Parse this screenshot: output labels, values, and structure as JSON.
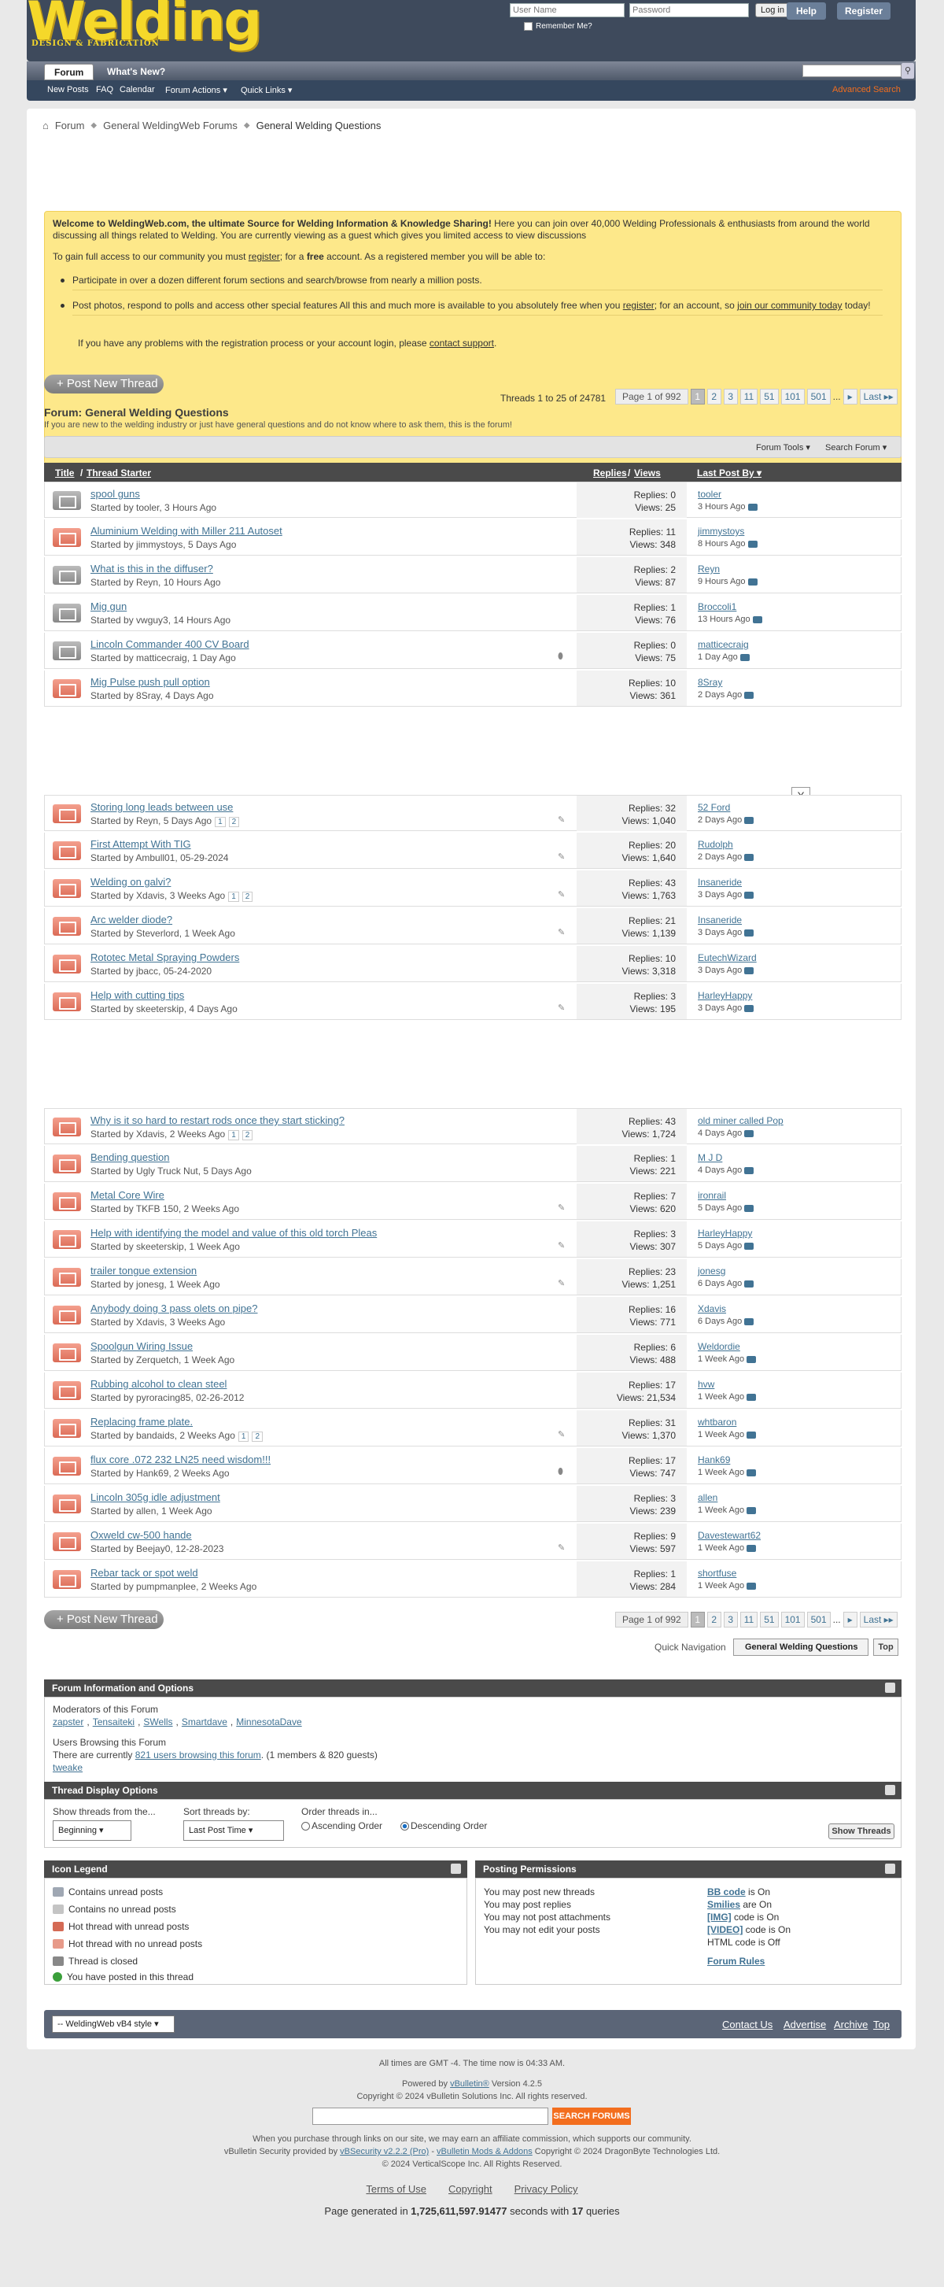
{
  "header": {
    "logo_main": "Welding",
    "logo_sub": "DESIGN & FABRICATION",
    "username_placeholder": "User Name",
    "password_placeholder": "Password",
    "login_button": "Log in",
    "remember_me": "Remember Me?",
    "help": "Help",
    "register": "Register"
  },
  "nav": {
    "tabs": [
      {
        "label": "Forum"
      },
      {
        "label": "What's New?"
      }
    ],
    "sub": [
      "New Posts",
      "FAQ",
      "Calendar",
      "Forum Actions ▾",
      "Quick Links ▾"
    ],
    "advanced_search": "Advanced Search"
  },
  "breadcrumb": [
    "Forum",
    "General WeldingWeb Forums",
    "General Welding Questions"
  ],
  "notice": {
    "welcome_bold": "Welcome to WeldingWeb.com, the ultimate Source for Welding Information & Knowledge Sharing!",
    "welcome_rest": " Here you can join over 40,000 Welding Professionals & enthusiasts from around the world discussing all things related to Welding. You are currently viewing as a guest which gives you limited access to view discussions",
    "access_a": "To gain full access to our community you must ",
    "access_link": "register",
    "access_b": "; for a ",
    "access_free": "free",
    "access_c": " account. As a registered member you will be able to:",
    "bullet1": "Participate in over a dozen different forum sections and search/browse from nearly a million posts.",
    "bullet2_a": "Post photos, respond to polls and access other special features All this and much more is available to you absolutely free when you ",
    "bullet2_link": "register",
    "bullet2_b": "; for an account, so ",
    "bullet2_link2": "join our community today",
    "bullet2_c": " today!",
    "problems_a": "If you have any problems with the registration process or your account login, please ",
    "problems_link": "contact support",
    "problems_b": "."
  },
  "post_new_thread": "+ Post New Thread",
  "threads_info": "Threads 1 to 25 of 24781",
  "pagination": {
    "label": "Page 1 of 992",
    "pages": [
      "1",
      "2",
      "3",
      "11",
      "51",
      "101",
      "501",
      "...",
      "▸",
      "Last ▸▸"
    ]
  },
  "forum": {
    "title": "Forum: General Welding Questions",
    "description": "If you are new to the welding industry or just have general questions and do not know where to ask them, this is the forum!",
    "tools": "Forum Tools ▾",
    "search": "Search Forum ▾"
  },
  "columns": {
    "title": "Title",
    "starter": "Thread Starter",
    "replies": "Replies",
    "views": "Views",
    "last_post": "Last Post By ▾"
  },
  "threads_group1": [
    {
      "title": "spool guns",
      "starter": "Started by tooler, 3 Hours Ago",
      "replies": "Replies: 0",
      "views": "Views: 25",
      "last_by": "tooler",
      "last_date": "3 Hours Ago",
      "icon": "gray"
    },
    {
      "title": "Aluminium Welding with Miller 211 Autoset",
      "starter": "Started by jimmystoys, 5 Days Ago",
      "replies": "Replies: 11",
      "views": "Views: 348",
      "last_by": "jimmystoys",
      "last_date": "8 Hours Ago",
      "icon": "hot"
    },
    {
      "title": "What is this in the diffuser?",
      "starter": "Started by Reyn, 10 Hours Ago",
      "replies": "Replies: 2",
      "views": "Views: 87",
      "last_by": "Reyn",
      "last_date": "9 Hours Ago",
      "icon": "gray"
    },
    {
      "title": "Mig gun",
      "starter": "Started by vwguy3, 14 Hours Ago",
      "replies": "Replies: 1",
      "views": "Views: 76",
      "last_by": "Broccoli1",
      "last_date": "13 Hours Ago",
      "icon": "gray"
    },
    {
      "title": "Lincoln Commander 400 CV Board",
      "starter": "Started by matticecraig, 1 Day Ago",
      "replies": "Replies: 0",
      "views": "Views: 75",
      "last_by": "matticecraig",
      "last_date": "1 Day Ago",
      "icon": "gray"
    },
    {
      "title": "Mig Pulse push pull option",
      "starter": "Started by 8Sray, 4 Days Ago",
      "replies": "Replies: 10",
      "views": "Views: 361",
      "last_by": "8Sray",
      "last_date": "2 Days Ago",
      "icon": "hot"
    }
  ],
  "ad_close": "X",
  "threads_group2": [
    {
      "title": "Storing long leads between use",
      "starter": "Started by Reyn, 5 Days Ago",
      "pages": [
        "1",
        "2"
      ],
      "replies": "Replies: 32",
      "views": "Views: 1,040",
      "last_by": "52 Ford",
      "last_date": "2 Days Ago"
    },
    {
      "title": "First Attempt With TIG",
      "starter": "Started by Ambull01, 05-29-2024",
      "replies": "Replies: 20",
      "views": "Views: 1,640",
      "last_by": "Rudolph",
      "last_date": "2 Days Ago"
    },
    {
      "title": "Welding on galvi?",
      "starter": "Started by Xdavis, 3 Weeks Ago",
      "pages": [
        "1",
        "2"
      ],
      "replies": "Replies: 43",
      "views": "Views: 1,763",
      "last_by": "Insaneride",
      "last_date": "3 Days Ago"
    },
    {
      "title": "Arc welder diode?",
      "starter": "Started by Steverlord, 1 Week Ago",
      "replies": "Replies: 21",
      "views": "Views: 1,139",
      "last_by": "Insaneride",
      "last_date": "3 Days Ago"
    },
    {
      "title": "Rototec Metal Spraying Powders",
      "starter": "Started by jbacc, 05-24-2020",
      "replies": "Replies: 10",
      "views": "Views: 3,318",
      "last_by": "EutechWizard",
      "last_date": "3 Days Ago"
    },
    {
      "title": "Help with cutting tips",
      "starter": "Started by skeeterskip, 4 Days Ago",
      "replies": "Replies: 3",
      "views": "Views: 195",
      "last_by": "HarleyHappy",
      "last_date": "3 Days Ago"
    }
  ],
  "threads_group3": [
    {
      "title": "Why is it so hard to restart rods once they start sticking?",
      "starter": "Started by Xdavis, 2 Weeks Ago",
      "pages": [
        "1",
        "2"
      ],
      "replies": "Replies: 43",
      "views": "Views: 1,724",
      "last_by": "old miner called Pop",
      "last_date": "4 Days Ago"
    },
    {
      "title": "Bending question",
      "starter": "Started by Ugly Truck Nut, 5 Days Ago",
      "replies": "Replies: 1",
      "views": "Views: 221",
      "last_by": "M J D",
      "last_date": "4 Days Ago"
    },
    {
      "title": "Metal Core Wire",
      "starter": "Started by TKFB 150, 2 Weeks Ago",
      "replies": "Replies: 7",
      "views": "Views: 620",
      "last_by": "ironrail",
      "last_date": "5 Days Ago"
    },
    {
      "title": "Help with identifying the model and value of this old torch Pleas",
      "starter": "Started by skeeterskip, 1 Week Ago",
      "replies": "Replies: 3",
      "views": "Views: 307",
      "last_by": "HarleyHappy",
      "last_date": "5 Days Ago"
    },
    {
      "title": "trailer tongue extension",
      "starter": "Started by jonesg, 1 Week Ago",
      "replies": "Replies: 23",
      "views": "Views: 1,251",
      "last_by": "jonesg",
      "last_date": "6 Days Ago"
    },
    {
      "title": "Anybody doing 3 pass olets on pipe?",
      "starter": "Started by Xdavis, 3 Weeks Ago",
      "replies": "Replies: 16",
      "views": "Views: 771",
      "last_by": "Xdavis",
      "last_date": "6 Days Ago"
    },
    {
      "title": "Spoolgun Wiring Issue",
      "starter": "Started by Zerquetch, 1 Week Ago",
      "replies": "Replies: 6",
      "views": "Views: 488",
      "last_by": "Weldordie",
      "last_date": "1 Week Ago"
    },
    {
      "title": "Rubbing alcohol to clean steel",
      "starter": "Started by pyroracing85, 02-26-2012",
      "replies": "Replies: 17",
      "views": "Views: 21,534",
      "last_by": "hvw",
      "last_date": "1 Week Ago"
    },
    {
      "title": "Replacing frame plate.",
      "starter": "Started by bandaids, 2 Weeks Ago",
      "pages": [
        "1",
        "2"
      ],
      "replies": "Replies: 31",
      "views": "Views: 1,370",
      "last_by": "whtbaron",
      "last_date": "1 Week Ago"
    },
    {
      "title": "flux core .072 232 LN25 need wisdom!!!",
      "starter": "Started by Hank69, 2 Weeks Ago",
      "replies": "Replies: 17",
      "views": "Views: 747",
      "last_by": "Hank69",
      "last_date": "1 Week Ago"
    },
    {
      "title": "Lincoln 305g idle adjustment",
      "starter": "Started by allen, 1 Week Ago",
      "replies": "Replies: 3",
      "views": "Views: 239",
      "last_by": "allen",
      "last_date": "1 Week Ago"
    },
    {
      "title": "Oxweld cw-500 hande",
      "starter": "Started by Beejay0, 12-28-2023",
      "replies": "Replies: 9",
      "views": "Views: 597",
      "last_by": "Davestewart62",
      "last_date": "1 Week Ago"
    },
    {
      "title": "Rebar tack or spot weld",
      "starter": "Started by pumpmanplee, 2 Weeks Ago",
      "replies": "Replies: 1",
      "views": "Views: 284",
      "last_by": "shortfuse",
      "last_date": "1 Week Ago"
    }
  ],
  "quick_nav": {
    "label": "Quick Navigation",
    "select": "General Welding Questions",
    "top": "Top"
  },
  "info": {
    "header": "Forum Information and Options",
    "moderators_label": "Moderators of this Forum",
    "moderators": [
      "zapster",
      "Tensaiteki",
      "SWells",
      "Smartdave",
      "MinnesotaDave"
    ],
    "users_label": "Users Browsing this Forum",
    "users_a": "There are currently ",
    "users_link": "821 users browsing this forum",
    "users_b": ". (1 members & 820 guests)",
    "member": "tweake"
  },
  "display": {
    "header": "Thread Display Options",
    "from_label": "Show threads from the...",
    "from_value": "Beginning",
    "sort_label": "Sort threads by:",
    "sort_value": "Last Post Time",
    "order_label": "Order threads in...",
    "asc": "Ascending Order",
    "desc": "Descending Order",
    "button": "Show Threads"
  },
  "legend": {
    "header": "Icon Legend",
    "items": [
      "Contains unread posts",
      "Contains no unread posts",
      "Hot thread with unread posts",
      "Hot thread with no unread posts",
      "Thread is closed",
      "You have posted in this thread"
    ]
  },
  "permissions": {
    "header": "Posting Permissions",
    "items": [
      "You may post new threads",
      "You may post replies",
      "You may not post attachments",
      "You may not edit your posts"
    ],
    "codes": [
      {
        "name": "BB code",
        "state": " is On"
      },
      {
        "name": "Smilies",
        "state": " are On"
      },
      {
        "name": "[IMG]",
        "state": " code is On"
      },
      {
        "name": "[VIDEO]",
        "state": " code is On"
      }
    ],
    "html": "HTML code is Off",
    "rules": "Forum Rules"
  },
  "footer": {
    "style": "-- WeldingWeb vB4 style",
    "links": [
      "Contact Us",
      "Advertise",
      "Archive",
      "Top"
    ],
    "time": "All times are GMT -4. The time now is 04:33 AM.",
    "powered_a": "Powered by ",
    "powered_link": "vBulletin®",
    "powered_b": " Version 4.2.5",
    "copyright1": "Copyright © 2024 vBulletin Solutions Inc. All rights reserved.",
    "search_button": "SEARCH FORUMS",
    "affiliate": "When you purchase through links on our site, we may earn an affiliate commission, which supports our community.",
    "security_a": "vBulletin Security provided by ",
    "security_link1": "vBSecurity v2.2.2 (Pro)",
    "security_mid": " - ",
    "security_link2": "vBulletin Mods & Addons",
    "security_b": " Copyright © 2024 DragonByte Technologies Ltd.",
    "copyright2": "© 2024 VerticalScope Inc. All Rights Reserved.",
    "legal": [
      "Terms of Use",
      "Copyright",
      "Privacy Policy"
    ],
    "generated_a": "Page generated in ",
    "generated_time": "1,725,611,597.91477",
    "generated_b": " seconds with ",
    "generated_queries": "17",
    "generated_c": " queries"
  }
}
